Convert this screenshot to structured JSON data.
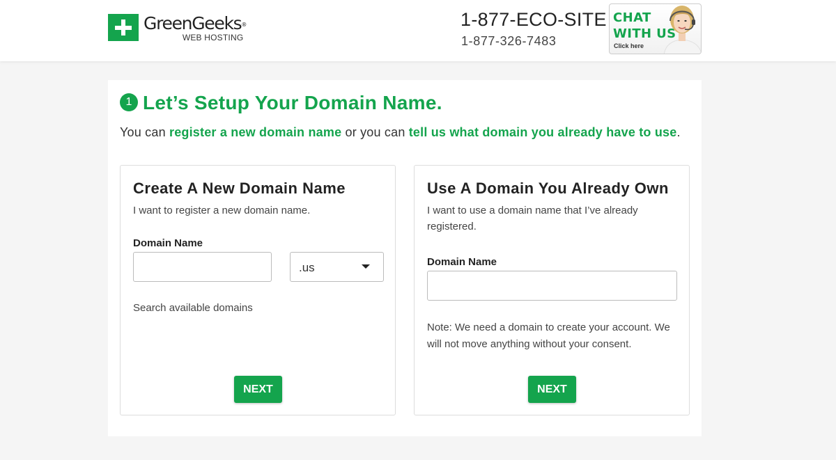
{
  "header": {
    "logo": {
      "name": "GreenGeeks",
      "trademark": "®",
      "subtitle": "WEB HOSTING",
      "icon": "plus-icon"
    },
    "phone_vanity": "1-877-ECO-SITE",
    "phone_number": "1-877-326-7483",
    "chat": {
      "line1": "CHAT",
      "line2": "WITH US",
      "line3": "Click here",
      "image": "support-agent-headset"
    }
  },
  "main": {
    "step_number": "1",
    "title": "Let’s Setup Your Domain Name.",
    "intro": {
      "part1": "You can ",
      "link1": "register a new domain name",
      "part2": " or you can ",
      "link2": "tell us what domain you already have to use",
      "part3": "."
    },
    "new_domain": {
      "title": "Create A New Domain Name",
      "description": "I want to register a new domain name.",
      "field_label": "Domain Name",
      "input_value": "",
      "tld_selected": ".us",
      "search_text": "Search available domains",
      "next_label": "NEXT"
    },
    "existing_domain": {
      "title": "Use A Domain You Already Own",
      "description": "I want to use a domain name that I’ve already registered.",
      "field_label": "Domain Name",
      "input_value": "",
      "note": "Note: We need a domain to create your account. We will not move anything without your consent.",
      "next_label": "NEXT"
    }
  },
  "colors": {
    "brand_green": "#14a44d",
    "background": "#f5f5f5",
    "text": "#333333"
  }
}
